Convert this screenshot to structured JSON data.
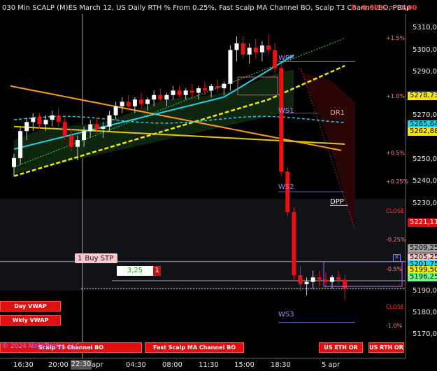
{
  "title": {
    "text": "030 Min SCALP (M)ES March 12, US Daily RTH % From 0.25%, Fast Scalp MA Channel BO, Scalp T3 Channel BO, PB4p",
    "drawdown": "E -0.02% = -1,00"
  },
  "price_axis": {
    "labels": [
      "5310,00",
      "5300,00",
      "5290,00",
      "5270,00",
      "5250,00",
      "5240,00",
      "5230,00",
      "5190,00",
      "5180,00",
      "5170,00"
    ],
    "boxes": [
      {
        "text": "5278,73",
        "bg": "#f5e800",
        "fg": "#000"
      },
      {
        "text": "5265,64",
        "bg": "#22d3ee",
        "fg": "#000"
      },
      {
        "text": "5262,88",
        "bg": "#f5e800",
        "fg": "#000"
      },
      {
        "text": "5221,11",
        "bg": "#e01010",
        "fg": "#fff"
      },
      {
        "text": "5209,25",
        "bg": "#a0a0a0",
        "fg": "#000"
      },
      {
        "text": "5205,25",
        "bg": "#f9c9cf",
        "fg": "#000"
      },
      {
        "text": "5201,75",
        "bg": "#22d3ee",
        "fg": "#000"
      },
      {
        "text": "5199,50",
        "bg": "#f5e800",
        "fg": "#000"
      },
      {
        "text": "5196,25",
        "bg": "#6dfc8a",
        "fg": "#000"
      }
    ]
  },
  "pct_labels": [
    {
      "text": "+1.5%",
      "color": "#ff8080"
    },
    {
      "text": "+1.0%",
      "color": "#ff8080"
    },
    {
      "text": "+0.5%",
      "color": "#ff8080"
    },
    {
      "text": "+0.25%",
      "color": "#ff8080"
    },
    {
      "text": "CLOSE",
      "color": "#ff3030"
    },
    {
      "text": "-0.25%",
      "color": "#ff8080"
    },
    {
      "text": "-0.5%",
      "color": "#ff8080"
    },
    {
      "text": "CLOSE",
      "color": "#ff3030"
    },
    {
      "text": "-1.0%",
      "color": "#ff8080"
    }
  ],
  "pivots": {
    "wpp": "WPP",
    "ws1": "WS1",
    "ws2": "WS2",
    "ws3": "WS3",
    "dr1": "DR1",
    "dpp": "DPP"
  },
  "time_axis": {
    "labels": [
      "16:30",
      "20:00",
      "apr",
      "04:30",
      "08:00",
      "11:30",
      "15:00",
      "18:30",
      "5 apr"
    ],
    "cursor": "22:30"
  },
  "order": {
    "qty": "1",
    "label": "Buy STP",
    "entry_qty_value": "3,25",
    "entry_qty_count": "1"
  },
  "buttons": {
    "day_vwap": "Day VWAP",
    "wkly_vwap": "Wkly VWAP",
    "scalp_t3": "Scalp T3 Channel BO",
    "fast_scalp": "Fast Scalp MA Channel BO",
    "us_eth": "US ETH OR",
    "us_rth": "US RTH OR"
  },
  "copyright": "© 2024 NinjaTrader, LLC",
  "chart_data": {
    "type": "candlestick",
    "title": "030 Min SCALP (M)ES March 12, US Daily RTH % From 0.25%, Fast Scalp MA Channel BO, Scalp T3 Channel BO, PB4p",
    "ylim": [
      5165,
      5318
    ],
    "x": [
      "16:30",
      "20:00",
      "apr",
      "04:30",
      "08:00",
      "11:30",
      "15:00",
      "18:30",
      "5 apr"
    ],
    "levels": {
      "WPP": 5297,
      "WS1": 5274,
      "WS2": 5239,
      "WS3": 5181,
      "DR1": 5274,
      "DPP": 5233,
      "CLOSE_high": 5228,
      "CLOSE_low": 5182
    },
    "candles": [
      [
        5250,
        5256,
        5246,
        5254
      ],
      [
        5254,
        5268,
        5251,
        5266
      ],
      [
        5266,
        5272,
        5262,
        5270
      ],
      [
        5270,
        5274,
        5266,
        5272
      ],
      [
        5272,
        5274,
        5267,
        5269
      ],
      [
        5269,
        5273,
        5266,
        5271
      ],
      [
        5271,
        5275,
        5268,
        5273
      ],
      [
        5273,
        5276,
        5268,
        5270
      ],
      [
        5270,
        5272,
        5262,
        5264
      ],
      [
        5264,
        5267,
        5257,
        5259
      ],
      [
        5259,
        5264,
        5253,
        5262
      ],
      [
        5262,
        5268,
        5259,
        5266
      ],
      [
        5266,
        5271,
        5263,
        5269
      ],
      [
        5269,
        5272,
        5265,
        5267
      ],
      [
        5267,
        5270,
        5263,
        5268
      ],
      [
        5268,
        5275,
        5266,
        5273
      ],
      [
        5273,
        5279,
        5271,
        5277
      ],
      [
        5277,
        5281,
        5274,
        5279
      ],
      [
        5279,
        5282,
        5275,
        5277
      ],
      [
        5277,
        5281,
        5274,
        5280
      ],
      [
        5280,
        5283,
        5276,
        5278
      ],
      [
        5278,
        5281,
        5275,
        5280
      ],
      [
        5280,
        5284,
        5277,
        5282
      ],
      [
        5282,
        5285,
        5279,
        5280
      ],
      [
        5280,
        5283,
        5277,
        5282
      ],
      [
        5282,
        5286,
        5280,
        5284
      ],
      [
        5284,
        5286,
        5281,
        5282
      ],
      [
        5282,
        5285,
        5280,
        5284
      ],
      [
        5284,
        5287,
        5281,
        5283
      ],
      [
        5283,
        5286,
        5280,
        5285
      ],
      [
        5285,
        5288,
        5282,
        5284
      ],
      [
        5284,
        5287,
        5281,
        5286
      ],
      [
        5286,
        5289,
        5283,
        5285
      ],
      [
        5285,
        5288,
        5282,
        5287
      ],
      [
        5287,
        5304,
        5284,
        5302
      ],
      [
        5302,
        5308,
        5297,
        5305
      ],
      [
        5305,
        5308,
        5298,
        5300
      ],
      [
        5300,
        5305,
        5296,
        5303
      ],
      [
        5303,
        5307,
        5298,
        5301
      ],
      [
        5301,
        5306,
        5297,
        5304
      ],
      [
        5304,
        5309,
        5300,
        5302
      ],
      [
        5302,
        5305,
        5292,
        5294
      ],
      [
        5294,
        5296,
        5246,
        5248
      ],
      [
        5248,
        5250,
        5228,
        5230
      ],
      [
        5230,
        5232,
        5200,
        5202
      ],
      [
        5202,
        5206,
        5195,
        5198
      ],
      [
        5198,
        5201,
        5193,
        5199
      ],
      [
        5199,
        5204,
        5196,
        5201
      ],
      [
        5201,
        5204,
        5197,
        5200
      ],
      [
        5200,
        5203,
        5196,
        5199
      ],
      [
        5199,
        5202,
        5196,
        5201
      ],
      [
        5201,
        5204,
        5198,
        5200
      ],
      [
        5200,
        5202,
        5191,
        5196
      ]
    ]
  }
}
